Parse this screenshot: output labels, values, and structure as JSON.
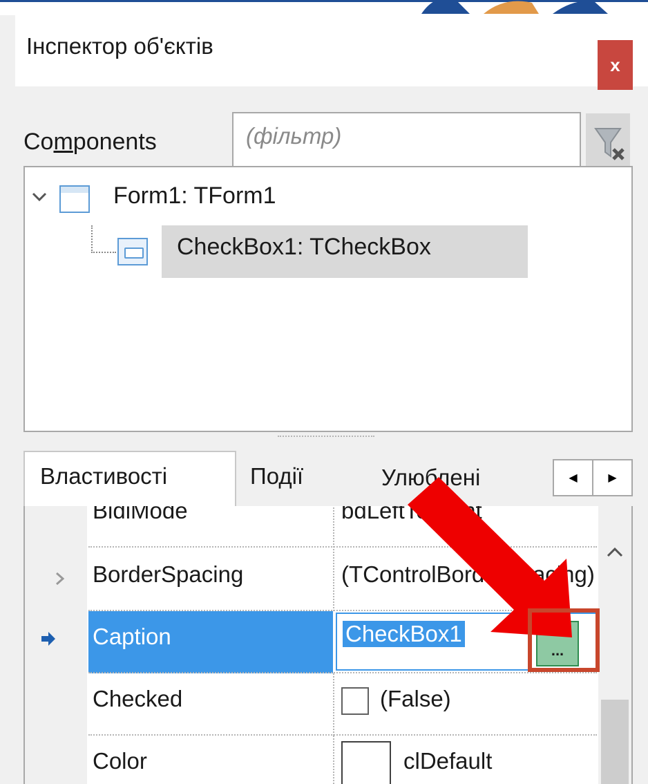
{
  "window": {
    "title": "Інспектор об'єктів",
    "close_label": "x"
  },
  "filter": {
    "label_pre": "Co",
    "label_underlined": "m",
    "label_post": "ponents",
    "placeholder": "(фільтр)"
  },
  "tree": {
    "items": [
      {
        "label": "Form1: TForm1"
      },
      {
        "label": "CheckBox1: TCheckBox"
      }
    ]
  },
  "tabs": [
    {
      "label": "Властивості"
    },
    {
      "label": "Події"
    },
    {
      "label": "Улюблені"
    }
  ],
  "properties": [
    {
      "name": "BidiMode",
      "value": "bdLeftToRight"
    },
    {
      "name": "BorderSpacing",
      "value": "(TControlBorderSpacing)"
    },
    {
      "name": "Caption",
      "value": "CheckBox1",
      "button": "..."
    },
    {
      "name": "Checked",
      "value": "(False)"
    },
    {
      "name": "Color",
      "value": "clDefault"
    }
  ],
  "colors": {
    "selected_row": "#3c97e8",
    "close_button": "#c8473f",
    "annotation_arrow": "#ee0000",
    "annotation_box": "#c8462c",
    "ellipsis_button": "#8ec9a3"
  }
}
